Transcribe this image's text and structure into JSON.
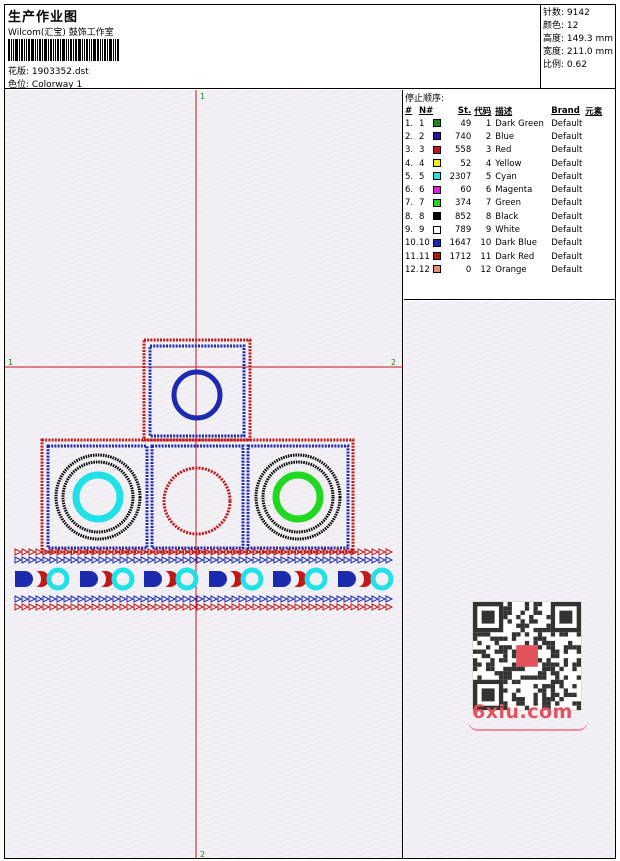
{
  "header": {
    "title": "生产作业图",
    "company": "Wilcom(汇宝) 鼓饰工作室",
    "design_line": "花版:  1903352.dst",
    "colorway_line": "色位:  Colorway 1"
  },
  "meta": {
    "stitches": "针数:  9142",
    "colors": "颜色:  12",
    "height": "高度:  149.3 mm",
    "width": "宽度:  211.0 mm",
    "scale": "比例:  0.62"
  },
  "axes": {
    "top_label": "1",
    "bottom_label": "2",
    "left_label": "1",
    "right_label": "2"
  },
  "stop_sequence": {
    "title": "停止顺序:",
    "headers": [
      "#",
      "N#",
      "St.",
      "代码",
      "描述",
      "Brand",
      "元素"
    ],
    "rows": [
      {
        "idx": "1.",
        "n": "1",
        "color": "#1a8a1a",
        "st": "49",
        "code": "1",
        "desc": "Dark Green",
        "brand": "Default"
      },
      {
        "idx": "2.",
        "n": "2",
        "color": "#1c1ca8",
        "st": "740",
        "code": "2",
        "desc": "Blue",
        "brand": "Default"
      },
      {
        "idx": "3.",
        "n": "3",
        "color": "#c01818",
        "st": "558",
        "code": "3",
        "desc": "Red",
        "brand": "Default"
      },
      {
        "idx": "4.",
        "n": "4",
        "color": "#f0f018",
        "st": "52",
        "code": "4",
        "desc": "Yellow",
        "brand": "Default"
      },
      {
        "idx": "5.",
        "n": "5",
        "color": "#20e0e8",
        "st": "2307",
        "code": "5",
        "desc": "Cyan",
        "brand": "Default"
      },
      {
        "idx": "6.",
        "n": "6",
        "color": "#e020d8",
        "st": "60",
        "code": "6",
        "desc": "Magenta",
        "brand": "Default"
      },
      {
        "idx": "7.",
        "n": "7",
        "color": "#20d820",
        "st": "374",
        "code": "7",
        "desc": "Green",
        "brand": "Default"
      },
      {
        "idx": "8.",
        "n": "8",
        "color": "#000000",
        "st": "852",
        "code": "8",
        "desc": "Black",
        "brand": "Default"
      },
      {
        "idx": "9.",
        "n": "9",
        "color": "#ffffff",
        "st": "789",
        "code": "9",
        "desc": "White",
        "brand": "Default"
      },
      {
        "idx": "10.",
        "n": "10",
        "color": "#1c2ab0",
        "st": "1647",
        "code": "10",
        "desc": "Dark Blue",
        "brand": "Default"
      },
      {
        "idx": "11.",
        "n": "11",
        "color": "#a81818",
        "st": "1712",
        "code": "11",
        "desc": "Dark Red",
        "brand": "Default"
      },
      {
        "idx": "12.",
        "n": "12",
        "color": "#f08878",
        "st": "0",
        "code": "12",
        "desc": "Orange",
        "brand": "Default"
      }
    ]
  },
  "watermark": "6xiu.com",
  "colors": {
    "guide": "#c8141e",
    "blue": "#1c2ab0",
    "red": "#c01818",
    "black": "#000000",
    "cyan": "#20e0e8",
    "green": "#20d820"
  }
}
